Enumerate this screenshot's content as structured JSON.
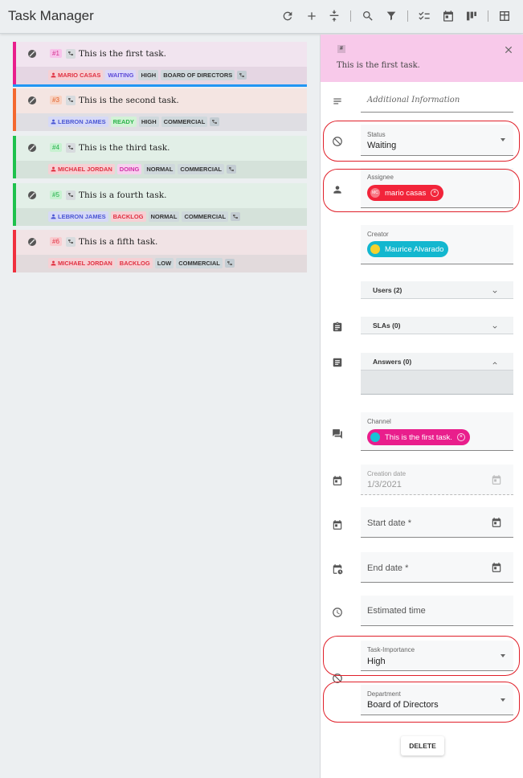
{
  "header": {
    "title": "Task Manager",
    "icons": [
      "refresh-icon",
      "add-icon",
      "collapse-icon",
      "search-icon",
      "filter-icon",
      "checklist-icon",
      "calendar-icon",
      "board-icon",
      "table-icon"
    ]
  },
  "tasks": [
    {
      "number": "#1",
      "title": "This is the first task.",
      "assignee": "MARIO CASAS",
      "status": "WAITING",
      "priority": "HIGH",
      "department": "BOARD OF DIRECTORS",
      "color": "#e91e8c",
      "bg": "#f1e4ef",
      "bg2": "#e5d6e3",
      "numBg": "#f7c3ea",
      "numColor": "#d4318f",
      "personBg": "#f6d0d4",
      "personColor": "#e03040",
      "statusBg": "#dcd8f8",
      "statusColor": "#5c4ad8"
    },
    {
      "number": "#3",
      "title": "This is the second task.",
      "assignee": "LEBRON JAMES",
      "status": "READY",
      "priority": "HIGH",
      "department": "COMMERCIAL",
      "color": "#f4682f",
      "bg": "#f4e5e2",
      "bg2": "#dfdee3",
      "numBg": "#f8d2c2",
      "numColor": "#e0622a",
      "personBg": "#d6d9f6",
      "personColor": "#4a56d4",
      "statusBg": "#d2f2d6",
      "statusColor": "#2bb34a"
    },
    {
      "number": "#4",
      "title": "This is the third task.",
      "assignee": "MICHAEL JORDAN",
      "status": "DOING",
      "priority": "NORMAL",
      "department": "COMMERCIAL",
      "color": "#1ec14c",
      "bg": "#e2efe7",
      "bg2": "#d5e2da",
      "numBg": "#c7f1d0",
      "numColor": "#22b14a",
      "personBg": "#f6d0d4",
      "personColor": "#e03040",
      "statusBg": "#f7d0ee",
      "statusColor": "#d02fa8"
    },
    {
      "number": "#5",
      "title": "This is a fourth task.",
      "assignee": "LEBRON JAMES",
      "status": "BACKLOG",
      "priority": "NORMAL",
      "department": "COMMERCIAL",
      "color": "#1ec14c",
      "bg": "#e2efe7",
      "bg2": "#d5e2da",
      "numBg": "#c7f1d0",
      "numColor": "#22b14a",
      "personBg": "#d6d9f6",
      "personColor": "#4a56d4",
      "statusBg": "#f6d0d4",
      "statusColor": "#e03040"
    },
    {
      "number": "#6",
      "title": "This is a fifth task.",
      "assignee": "MICHAEL JORDAN",
      "status": "BACKLOG",
      "priority": "LOW",
      "department": "COMMERCIAL",
      "color": "#f0303e",
      "bg": "#f1e3e5",
      "bg2": "#e2dadc",
      "numBg": "#f8ccd0",
      "numColor": "#e23545",
      "personBg": "#f6d0d4",
      "personColor": "#e03040",
      "statusBg": "#f6d0d4",
      "statusColor": "#e03040"
    }
  ],
  "panel": {
    "hash": "#",
    "title": "This is the first task.",
    "additional_info_placeholder": "Additional Information",
    "status": {
      "label": "Status",
      "value": "Waiting"
    },
    "assignee": {
      "label": "Assignee",
      "name": "mario casas",
      "initials": "MC"
    },
    "creator": {
      "label": "Creator",
      "name": "Maurice Alvarado"
    },
    "users": "Users (2)",
    "slas": "SLAs (0)",
    "answers": "Answers (0)",
    "channel": {
      "label": "Channel",
      "name": "This is the first task."
    },
    "creation_date": {
      "label": "Creation date",
      "value": "1/3/2021"
    },
    "start_date": "Start date *",
    "end_date": "End date *",
    "estimated_time": "Estimated time",
    "importance": {
      "label": "Task-Importance",
      "value": "High"
    },
    "department": {
      "label": "Department",
      "value": "Board of Directors"
    },
    "delete_label": "DELETE"
  }
}
